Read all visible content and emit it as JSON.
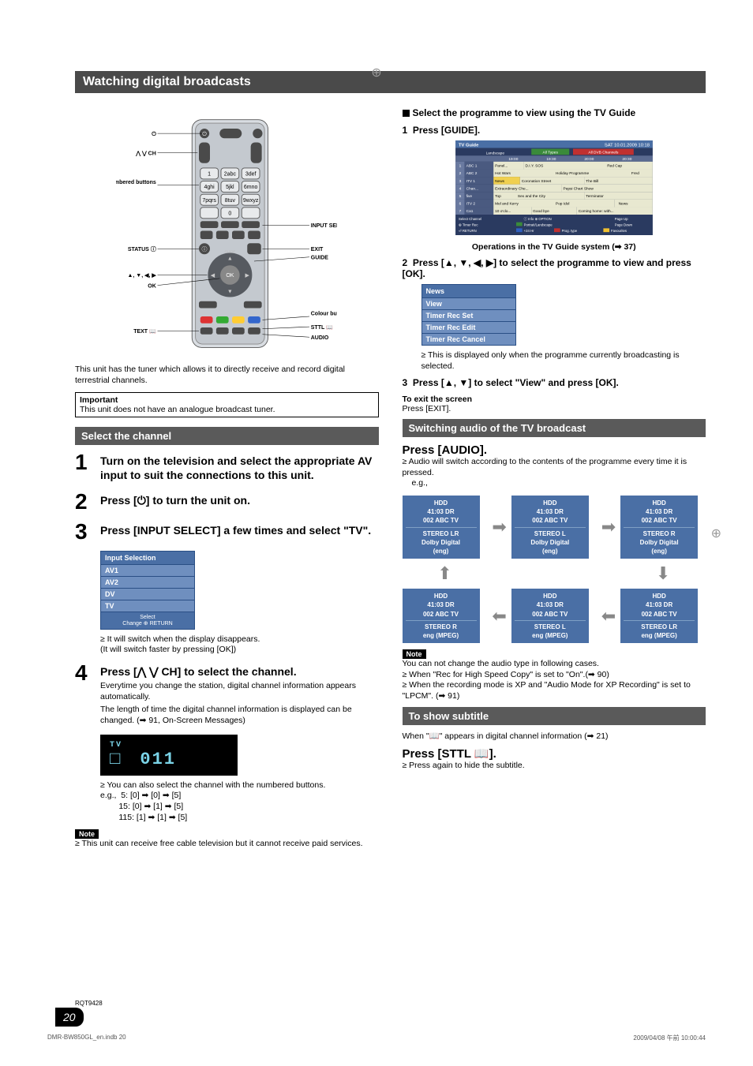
{
  "title": "Watching digital broadcasts",
  "remote": {
    "labels": {
      "ch": "⋀ ⋁ CH",
      "numbered": "Numbered buttons",
      "status": "STATUS ⓘ",
      "arrows": "▲, ▼, ◀, ▶",
      "ok": "OK",
      "text": "TEXT 📖",
      "input_select": "INPUT SELECT",
      "exit": "EXIT",
      "guide": "GUIDE",
      "colour": "Colour buttons",
      "sttl": "STTL 📖",
      "audio": "AUDIO"
    },
    "caption": "This unit has the tuner which allows it to directly receive and record digital terrestrial channels."
  },
  "important": {
    "title": "Important",
    "text": "This unit does not have an analogue broadcast tuner."
  },
  "select_channel": {
    "header": "Select the channel",
    "step1": "Turn on the television and select the appropriate AV input to suit the connections to this unit.",
    "step2": "Press [⏻] to turn the unit on.",
    "step3": "Press [INPUT SELECT] a few times and select \"TV\".",
    "input_selection": {
      "title": "Input Selection",
      "items": [
        "AV1",
        "AV2",
        "DV",
        "TV"
      ],
      "footer_select": "Select",
      "footer_change": "Change",
      "footer_return": "RETURN"
    },
    "step3_note1": "≥ It will switch when the display disappears.",
    "step3_note2": "(It will switch faster by pressing [OK])",
    "step4": "Press [⋀ ⋁ CH] to select the channel.",
    "step4_sub1": "Everytime you change the station, digital channel information appears automatically.",
    "step4_sub2": "The length of time the digital channel information is displayed can be changed. (➡ 91, On-Screen Messages)",
    "channel_display": "TV 0 1 1",
    "step4_note": "≥ You can also select the channel with the numbered buttons.",
    "examples_label": "e.g.,",
    "examples": [
      "5:    [0] ➡ [0] ➡ [5]",
      "15:   [0] ➡ [1] ➡ [5]",
      "115: [1] ➡ [1] ➡ [5]"
    ],
    "note_tag": "Note",
    "final_note": "≥ This unit can receive free cable television but it cannot receive paid services."
  },
  "programme": {
    "heading": "Select the programme to view using the TV Guide",
    "step1": "Press [GUIDE].",
    "guide_caption": "Operations in the TV Guide system (➡ 37)",
    "tvguide": {
      "title": "TV Guide",
      "datetime": "SAT 10.01.2009 10:18",
      "channel_label": "Landscape",
      "all_types": "All Types",
      "all_dvb": "All DVB Channels",
      "time_header": [
        "19:00",
        "19:30",
        "20:00",
        "20:30"
      ],
      "rows": [
        {
          "num": "1",
          "ch": "ABC 1",
          "cells": [
            "Panel...",
            "D.I.Y. SOS",
            "",
            "Red Cap"
          ]
        },
        {
          "num": "2",
          "ch": "ABC 2",
          "cells": [
            "Hot Wars",
            "",
            "Holiday Programme",
            "Fred"
          ]
        },
        {
          "num": "3",
          "ch": "ITV 1",
          "cells": [
            "News",
            "Coronation Street",
            "The Bill",
            ""
          ]
        },
        {
          "num": "4",
          "ch": "Chan...",
          "cells": [
            "Extraordinary Che...",
            "Pepsi Chart Show",
            "",
            ""
          ]
        },
        {
          "num": "5",
          "ch": "five",
          "cells": [
            "Top",
            "Sex and the City",
            "Terminator",
            ""
          ]
        },
        {
          "num": "6",
          "ch": "ITV 2",
          "cells": [
            "Mel and Kerry",
            "Pop Idol",
            "",
            "News"
          ]
        },
        {
          "num": "7",
          "ch": "Ca1",
          "cells": [
            "10 o'clo...",
            "Good bye",
            "",
            "Coming home: with..."
          ]
        }
      ],
      "footer": [
        "Select Channel",
        "Info",
        "OPTION",
        "Page Up",
        "Timer Rec",
        "Portrait/Landscape",
        "Page Down",
        "RETURN",
        "+24 Hr",
        "Prog. type",
        "Favourites"
      ]
    },
    "step2": "Press [▲, ▼, ◀, ▶] to select the programme to view and press [OK].",
    "menu": {
      "header": "News",
      "items": [
        "View",
        "Timer Rec Set",
        "Timer Rec Edit",
        "Timer Rec Cancel"
      ]
    },
    "menu_note": "≥ This is displayed only when the programme currently broadcasting is selected.",
    "step3": "Press [▲, ▼] to select \"View\" and press [OK].",
    "exit_label": "To exit the screen",
    "exit_text": "Press [EXIT]."
  },
  "switching_audio": {
    "header": "Switching audio of the TV broadcast",
    "press": "Press [AUDIO].",
    "sub": "≥ Audio will switch according to the contents of the programme every time it is pressed.",
    "eg": "e.g.,",
    "boxes": [
      {
        "hdd": "HDD",
        "time": "41:03 DR",
        "ch": "002 ABC TV",
        "audio1": "STEREO LR",
        "audio2": "Dolby Digital",
        "audio3": "(eng)"
      },
      {
        "hdd": "HDD",
        "time": "41:03 DR",
        "ch": "002 ABC TV",
        "audio1": "STEREO L",
        "audio2": "Dolby Digital",
        "audio3": "(eng)"
      },
      {
        "hdd": "HDD",
        "time": "41:03 DR",
        "ch": "002 ABC TV",
        "audio1": "STEREO R",
        "audio2": "Dolby Digital",
        "audio3": "(eng)"
      },
      {
        "hdd": "HDD",
        "time": "41:03 DR",
        "ch": "002 ABC TV",
        "audio1": "STEREO R",
        "audio2": "eng (MPEG)",
        "audio3": ""
      },
      {
        "hdd": "HDD",
        "time": "41:03 DR",
        "ch": "002 ABC TV",
        "audio1": "STEREO L",
        "audio2": "eng (MPEG)",
        "audio3": ""
      },
      {
        "hdd": "HDD",
        "time": "41:03 DR",
        "ch": "002 ABC TV",
        "audio1": "STEREO LR",
        "audio2": "eng (MPEG)",
        "audio3": ""
      }
    ],
    "note_tag": "Note",
    "note1": "You can not change the audio type in following cases.",
    "note2": "≥ When \"Rec for High Speed Copy\" is set to \"On\".(➡ 90)",
    "note3": "≥ When the recording mode is XP and \"Audio Mode for XP Recording\" is set to \"LPCM\". (➡ 91)"
  },
  "subtitle": {
    "header": "To show subtitle",
    "when": "When \"📖\" appears in digital channel information (➡ 21)",
    "press": "Press [STTL 📖].",
    "note": "≥ Press again to hide the subtitle."
  },
  "page": {
    "rqt": "RQT9428",
    "num": "20",
    "footer_left": "DMR-BW850GL_en.indb   20",
    "footer_right": "2009/04/08   午前 10:00:44"
  }
}
